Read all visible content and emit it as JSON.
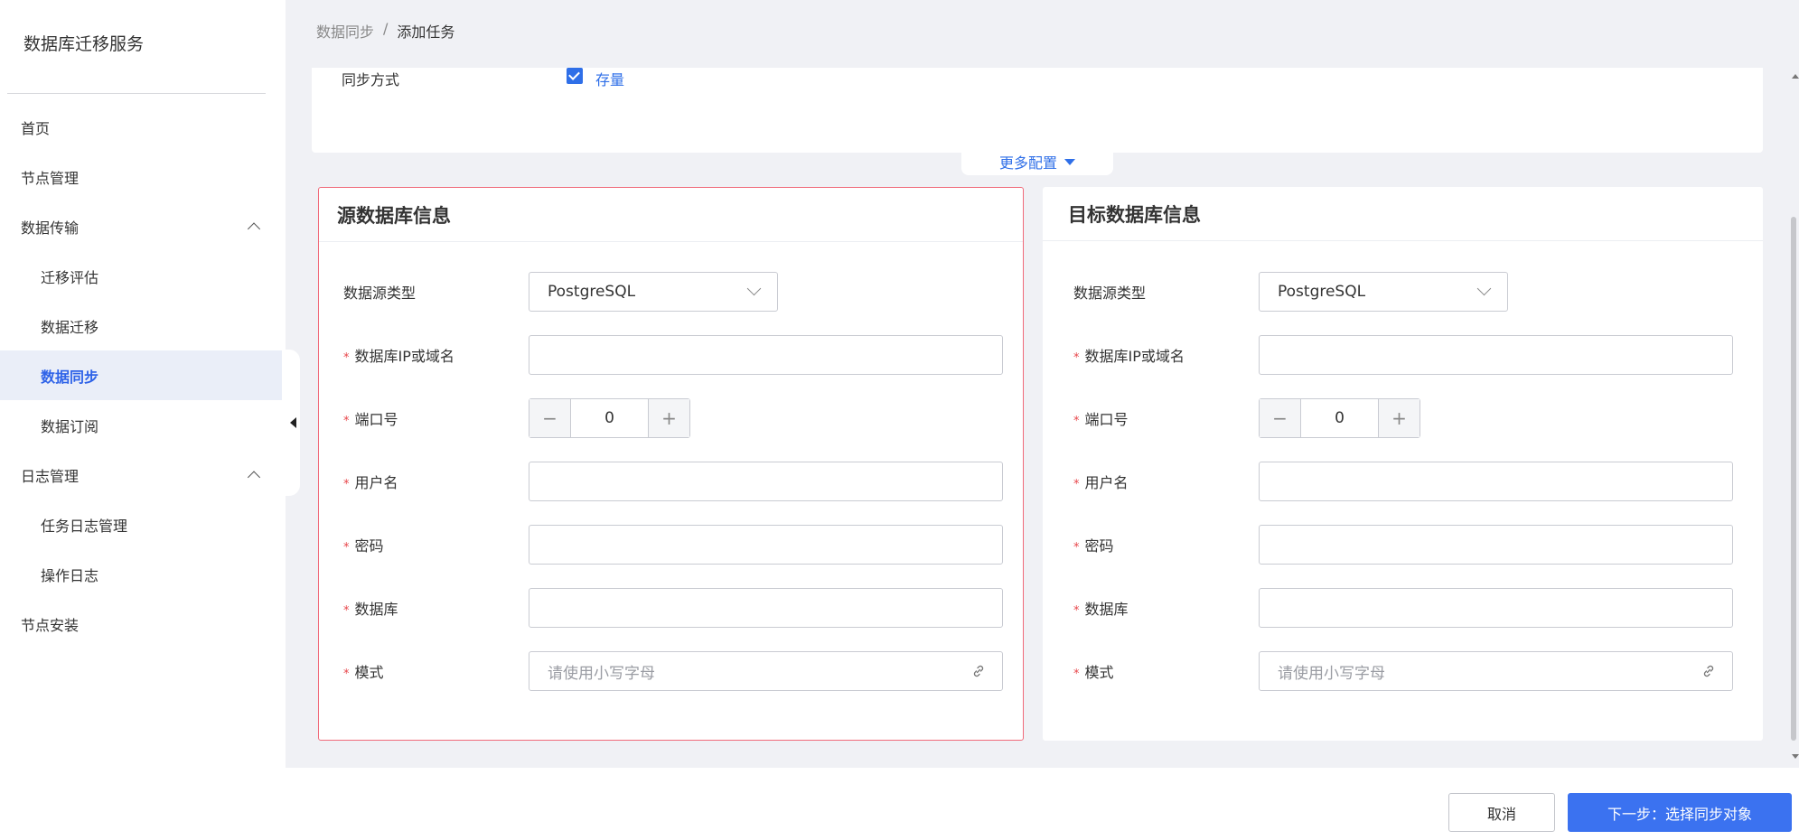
{
  "app": {
    "title": "数据库迁移服务"
  },
  "sidebar": {
    "items": [
      {
        "label": "首页",
        "level": 1,
        "active": false,
        "expandable": false
      },
      {
        "label": "节点管理",
        "level": 1,
        "active": false,
        "expandable": false
      },
      {
        "label": "数据传输",
        "level": 1,
        "active": false,
        "expandable": true,
        "expanded": true
      },
      {
        "label": "迁移评估",
        "level": 2,
        "active": false
      },
      {
        "label": "数据迁移",
        "level": 2,
        "active": false
      },
      {
        "label": "数据同步",
        "level": 2,
        "active": true
      },
      {
        "label": "数据订阅",
        "level": 2,
        "active": false
      },
      {
        "label": "日志管理",
        "level": 1,
        "active": false,
        "expandable": true,
        "expanded": true
      },
      {
        "label": "任务日志管理",
        "level": 2,
        "active": false
      },
      {
        "label": "操作日志",
        "level": 2,
        "active": false
      },
      {
        "label": "节点安装",
        "level": 1,
        "active": false,
        "expandable": false
      }
    ]
  },
  "breadcrumb": {
    "parent": "数据同步",
    "separator": "/",
    "current": "添加任务"
  },
  "config": {
    "sync_mode_label": "同步方式",
    "sync_mode_option": "存量",
    "sync_mode_checked": true,
    "more_config": "更多配置"
  },
  "source": {
    "title": "源数据库信息",
    "db_type_label": "数据源类型",
    "db_type_value": "PostgreSQL",
    "host_label": "数据库IP或域名",
    "host_value": "",
    "port_label": "端口号",
    "port_value": "0",
    "user_label": "用户名",
    "user_value": "",
    "password_label": "密码",
    "password_value": "",
    "database_label": "数据库",
    "database_value": "",
    "schema_label": "模式",
    "schema_placeholder": "请使用小写字母"
  },
  "target": {
    "title": "目标数据库信息",
    "db_type_label": "数据源类型",
    "db_type_value": "PostgreSQL",
    "host_label": "数据库IP或域名",
    "host_value": "",
    "port_label": "端口号",
    "port_value": "0",
    "user_label": "用户名",
    "user_value": "",
    "password_label": "密码",
    "password_value": "",
    "database_label": "数据库",
    "database_value": "",
    "schema_label": "模式",
    "schema_placeholder": "请使用小写字母"
  },
  "stepper": {
    "minus": "−",
    "plus": "+"
  },
  "required_mark": "*",
  "footer": {
    "cancel_label": "取消",
    "next_label": "下一步：选择同步对象"
  },
  "colors": {
    "accent": "#2f6fe8",
    "primary_button": "#3b72f0",
    "error_border": "#f06b7a",
    "required": "#e8474c"
  },
  "icons": {
    "checkbox": "check-icon",
    "select_arrow": "chevron-down-icon",
    "schema_suffix": "link-icon",
    "collapse": "caret-left-icon"
  }
}
